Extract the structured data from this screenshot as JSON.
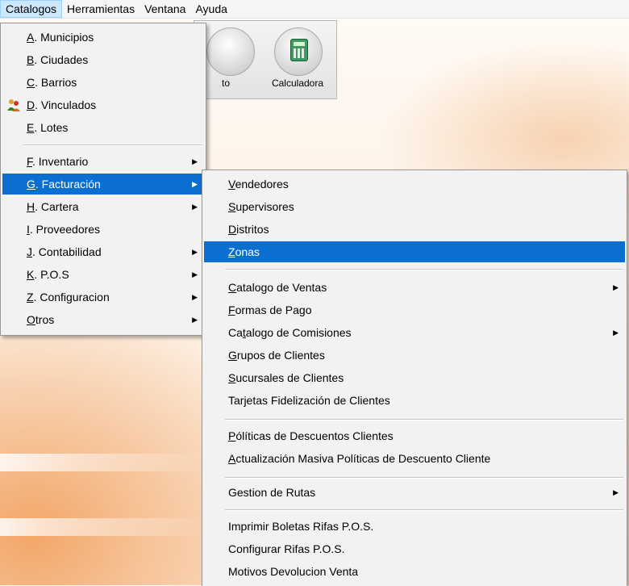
{
  "menubar": {
    "items": [
      "Catalogos",
      "Herramientas",
      "Ventana",
      "Ayuda"
    ]
  },
  "toolbar": {
    "button_1_label": "to",
    "button_2_label": "Calculadora"
  },
  "catalogos_menu": [
    {
      "mnem": "A",
      "rest": ". Municipios"
    },
    {
      "mnem": "B",
      "rest": ". Ciudades"
    },
    {
      "mnem": "C",
      "rest": ". Barrios"
    },
    {
      "mnem": "D",
      "rest": ". Vinculados"
    },
    {
      "mnem": "E",
      "rest": ". Lotes"
    },
    {
      "mnem": "F",
      "rest": ".  Inventario"
    },
    {
      "mnem": "G",
      "rest": ". Facturación"
    },
    {
      "mnem": "H",
      "rest": ". Cartera"
    },
    {
      "mnem": "I",
      "rest": ".  Proveedores"
    },
    {
      "mnem": "J",
      "rest": ". Contabilidad"
    },
    {
      "mnem": "K",
      "rest": ". P.O.S"
    },
    {
      "mnem": "Z",
      "rest": ". Configuracion"
    },
    {
      "mnem": "O",
      "rest": "tros"
    }
  ],
  "facturacion_menu": [
    {
      "pre": "",
      "mnem": "V",
      "rest": "endedores"
    },
    {
      "pre": "",
      "mnem": "S",
      "rest": "upervisores"
    },
    {
      "pre": "",
      "mnem": "D",
      "rest": "istritos"
    },
    {
      "pre": "",
      "mnem": "Z",
      "rest": "onas"
    },
    {
      "pre": "",
      "mnem": "C",
      "rest": "atalogo de Ventas"
    },
    {
      "pre": "",
      "mnem": "F",
      "rest": "ormas de Pago"
    },
    {
      "pre": "Ca",
      "mnem": "t",
      "rest": "alogo de Comisiones"
    },
    {
      "pre": "",
      "mnem": "G",
      "rest": "rupos de Clientes"
    },
    {
      "pre": "",
      "mnem": "S",
      "rest": "ucursales de Clientes"
    },
    {
      "pre": "Tarjetas Fidelización de Clientes",
      "mnem": "",
      "rest": ""
    },
    {
      "pre": "",
      "mnem": "P",
      "rest": "ólíticas de Descuentos Clientes"
    },
    {
      "pre": "",
      "mnem": "A",
      "rest": "ctualización Masiva Políticas de Descuento Cliente"
    },
    {
      "pre": "Gestion de  Rutas",
      "mnem": "",
      "rest": ""
    },
    {
      "pre": "Imprimir Boletas Rifas P.O.S.",
      "mnem": "",
      "rest": ""
    },
    {
      "pre": "Configurar Rifas  P.O.S.",
      "mnem": "",
      "rest": ""
    },
    {
      "pre": "Motivos Devolucion Venta",
      "mnem": "",
      "rest": ""
    }
  ]
}
